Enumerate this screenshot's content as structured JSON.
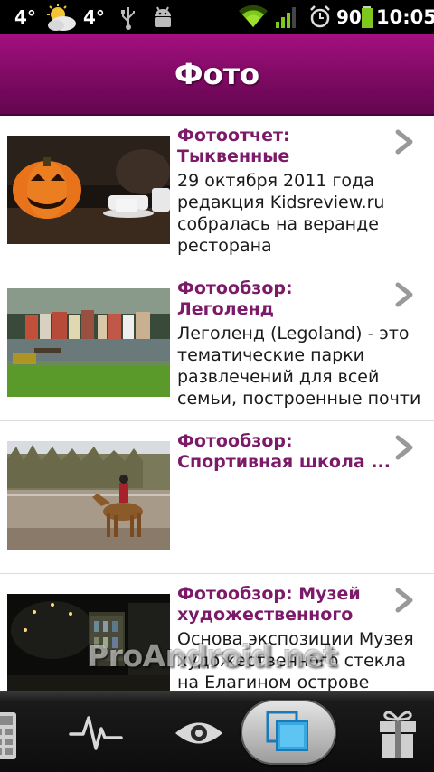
{
  "status_bar": {
    "temp_left": "4°",
    "temp_right": "4°",
    "battery": "90",
    "time": "10:05",
    "icons": [
      "weather-partly-cloudy-icon",
      "usb-icon",
      "android-debug-icon",
      "wifi-icon",
      "signal-icon",
      "alarm-icon",
      "battery-icon"
    ]
  },
  "header": {
    "title": "Фото"
  },
  "list": [
    {
      "title": "Фотоотчет: Тыквенные посидел...",
      "description": "29 октября 2011 года редакция Kidsreview.ru собралась на веранде ресторана “Труффальдино”."
    },
    {
      "title": "Фотообзор: Леголенд (Legoland)...",
      "description": "Леголенд (Legoland) - это тематические парки развлечений для всей семьи, построенные почти"
    },
    {
      "title": "Фотообзор: Спортивная школа ...",
      "description": ""
    },
    {
      "title": "Фотообзор: Музей художественного ст...",
      "description": "Основа экспозиции Музея художественного стекла на Елагином острове коллекция Ленинградского"
    }
  ],
  "watermark": "ProAndroid.net",
  "tabs": [
    "calculator-icon",
    "pulse-icon",
    "eye-icon",
    "gallery-icon",
    "gift-icon"
  ],
  "colors": {
    "accent": "#7c1968",
    "header": "#8a0c6d",
    "tab_active": "#3aa8e0"
  }
}
